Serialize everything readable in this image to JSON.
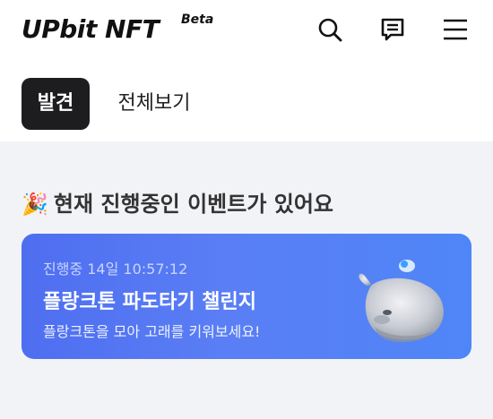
{
  "header": {
    "logo_text": "UPbit NFT",
    "logo_beta": "Beta",
    "icons": [
      "search-icon",
      "chat-icon",
      "menu-icon"
    ]
  },
  "nav": {
    "tabs": [
      {
        "label": "발견",
        "active": true
      },
      {
        "label": "전체보기",
        "active": false
      }
    ]
  },
  "section": {
    "emoji": "🎉",
    "title": "현재 진행중인 이벤트가 있어요"
  },
  "event": {
    "status": "진행중 14일 10:57:12",
    "title": "플랑크톤 파도타기 챌린지",
    "description": "플랑크톤을 모아 고래를 키워보세요!",
    "image": "whale-illustration"
  },
  "colors": {
    "accent": "#1d1d1f",
    "card_gradient_start": "#4e6ef0",
    "card_gradient_end": "#4f86f7",
    "background": "#f2f3f7"
  }
}
